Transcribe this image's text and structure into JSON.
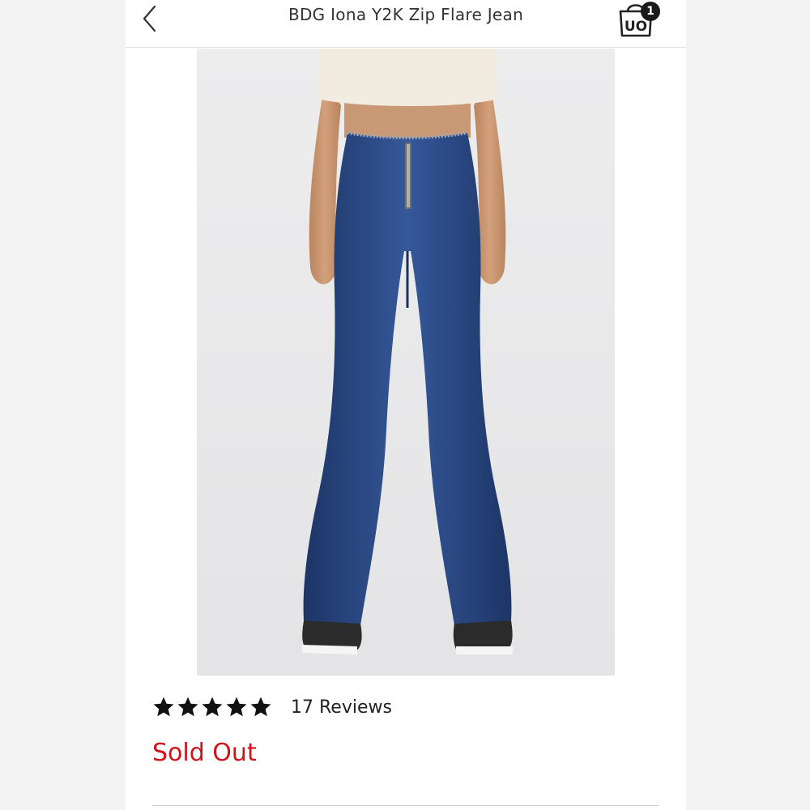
{
  "header": {
    "title": "BDG Iona Y2K Zip Flare Jean",
    "back_icon": "chevron-left-icon",
    "bag_icon": "shopping-bag-icon",
    "bag_logo_text": "UO",
    "bag_count": "1"
  },
  "product": {
    "image_icon": "product-photo",
    "rating": {
      "stars": 5,
      "reviews_label": "17 Reviews"
    },
    "status": "Sold Out"
  },
  "colors": {
    "accent_red": "#d0141b",
    "text": "#333333",
    "star": "#111111"
  }
}
